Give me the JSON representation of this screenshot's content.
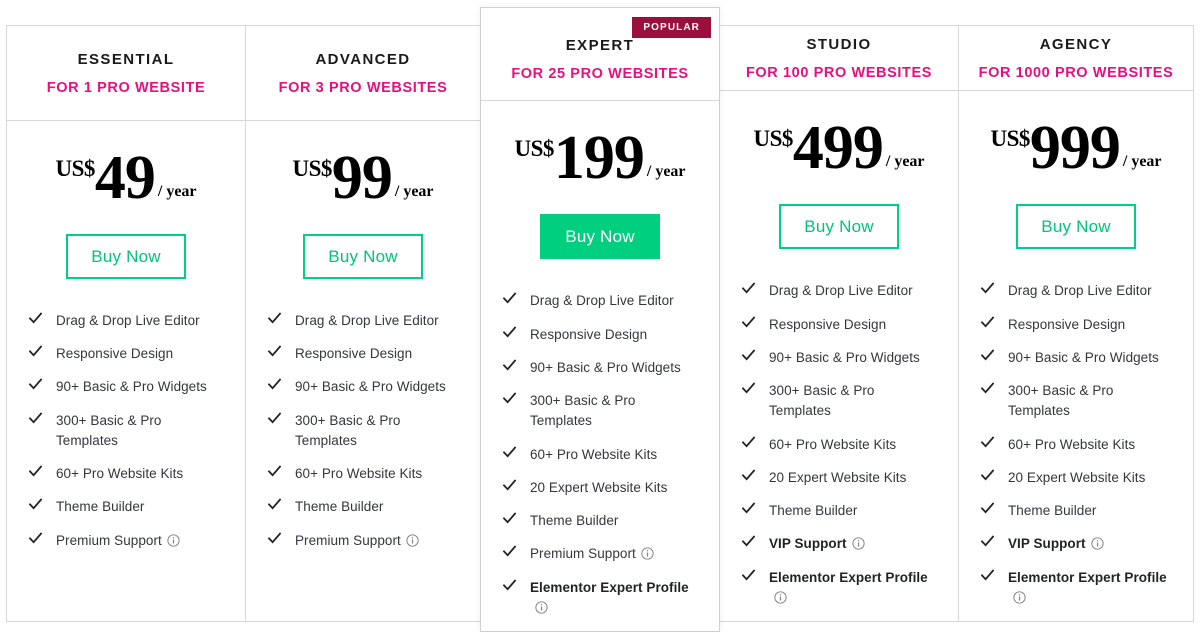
{
  "colors": {
    "accent_pink": "#e5107e",
    "badge_maroon": "#9b0f3c",
    "green": "#00cf7f",
    "border": "#d8d8d8",
    "text": "#33373d"
  },
  "badge": {
    "label": "POPULAR"
  },
  "common": {
    "buy_label": "Buy Now",
    "currency": "US$",
    "period": "/ year",
    "check_icon": "check-icon",
    "info_icon": "info-icon"
  },
  "plans": [
    {
      "name": "ESSENTIAL",
      "subtitle": "FOR 1 PRO WEBSITE",
      "currency": "US$",
      "price": "49",
      "period": "/ year",
      "buy_label": "Buy Now",
      "featured": false,
      "badge": null,
      "features": [
        {
          "text": "Drag & Drop Live Editor",
          "bold": false,
          "info": false
        },
        {
          "text": "Responsive Design",
          "bold": false,
          "info": false
        },
        {
          "text": "90+ Basic & Pro Widgets",
          "bold": false,
          "info": false
        },
        {
          "text": "300+ Basic & Pro Templates",
          "bold": false,
          "info": false
        },
        {
          "text": "60+ Pro Website Kits",
          "bold": false,
          "info": false
        },
        {
          "text": "Theme Builder",
          "bold": false,
          "info": false
        },
        {
          "text": "Premium Support",
          "bold": false,
          "info": true
        }
      ]
    },
    {
      "name": "ADVANCED",
      "subtitle": "FOR 3 PRO WEBSITES",
      "currency": "US$",
      "price": "99",
      "period": "/ year",
      "buy_label": "Buy Now",
      "featured": false,
      "badge": null,
      "features": [
        {
          "text": "Drag & Drop Live Editor",
          "bold": false,
          "info": false
        },
        {
          "text": "Responsive Design",
          "bold": false,
          "info": false
        },
        {
          "text": "90+ Basic & Pro Widgets",
          "bold": false,
          "info": false
        },
        {
          "text": "300+ Basic & Pro Templates",
          "bold": false,
          "info": false
        },
        {
          "text": "60+ Pro Website Kits",
          "bold": false,
          "info": false
        },
        {
          "text": "Theme Builder",
          "bold": false,
          "info": false
        },
        {
          "text": "Premium Support",
          "bold": false,
          "info": true
        }
      ]
    },
    {
      "name": "EXPERT",
      "subtitle": "FOR 25 PRO WEBSITES",
      "currency": "US$",
      "price": "199",
      "period": "/ year",
      "buy_label": "Buy Now",
      "featured": true,
      "badge": "POPULAR",
      "features": [
        {
          "text": "Drag & Drop Live Editor",
          "bold": false,
          "info": false
        },
        {
          "text": "Responsive Design",
          "bold": false,
          "info": false
        },
        {
          "text": "90+ Basic & Pro Widgets",
          "bold": false,
          "info": false
        },
        {
          "text": "300+ Basic & Pro Templates",
          "bold": false,
          "info": false
        },
        {
          "text": "60+ Pro Website Kits",
          "bold": false,
          "info": false
        },
        {
          "text": "20 Expert Website Kits",
          "bold": false,
          "info": false
        },
        {
          "text": "Theme Builder",
          "bold": false,
          "info": false
        },
        {
          "text": "Premium Support",
          "bold": false,
          "info": true
        },
        {
          "text": "Elementor Expert Profile",
          "bold": true,
          "info": true
        }
      ]
    },
    {
      "name": "STUDIO",
      "subtitle": "FOR 100 PRO WEBSITES",
      "currency": "US$",
      "price": "499",
      "period": "/ year",
      "buy_label": "Buy Now",
      "featured": false,
      "badge": null,
      "features": [
        {
          "text": "Drag & Drop Live Editor",
          "bold": false,
          "info": false
        },
        {
          "text": "Responsive Design",
          "bold": false,
          "info": false
        },
        {
          "text": "90+ Basic & Pro Widgets",
          "bold": false,
          "info": false
        },
        {
          "text": "300+ Basic & Pro Templates",
          "bold": false,
          "info": false
        },
        {
          "text": "60+ Pro Website Kits",
          "bold": false,
          "info": false
        },
        {
          "text": "20 Expert Website Kits",
          "bold": false,
          "info": false
        },
        {
          "text": "Theme Builder",
          "bold": false,
          "info": false
        },
        {
          "text": "VIP Support",
          "bold": true,
          "info": true
        },
        {
          "text": "Elementor Expert Profile",
          "bold": true,
          "info": true
        }
      ]
    },
    {
      "name": "AGENCY",
      "subtitle": "FOR 1000 PRO WEBSITES",
      "currency": "US$",
      "price": "999",
      "period": "/ year",
      "buy_label": "Buy Now",
      "featured": false,
      "badge": null,
      "features": [
        {
          "text": "Drag & Drop Live Editor",
          "bold": false,
          "info": false
        },
        {
          "text": "Responsive Design",
          "bold": false,
          "info": false
        },
        {
          "text": "90+ Basic & Pro Widgets",
          "bold": false,
          "info": false
        },
        {
          "text": "300+ Basic & Pro Templates",
          "bold": false,
          "info": false
        },
        {
          "text": "60+ Pro Website Kits",
          "bold": false,
          "info": false
        },
        {
          "text": "20 Expert Website Kits",
          "bold": false,
          "info": false
        },
        {
          "text": "Theme Builder",
          "bold": false,
          "info": false
        },
        {
          "text": "VIP Support",
          "bold": true,
          "info": true
        },
        {
          "text": "Elementor Expert Profile",
          "bold": true,
          "info": true
        }
      ]
    }
  ]
}
